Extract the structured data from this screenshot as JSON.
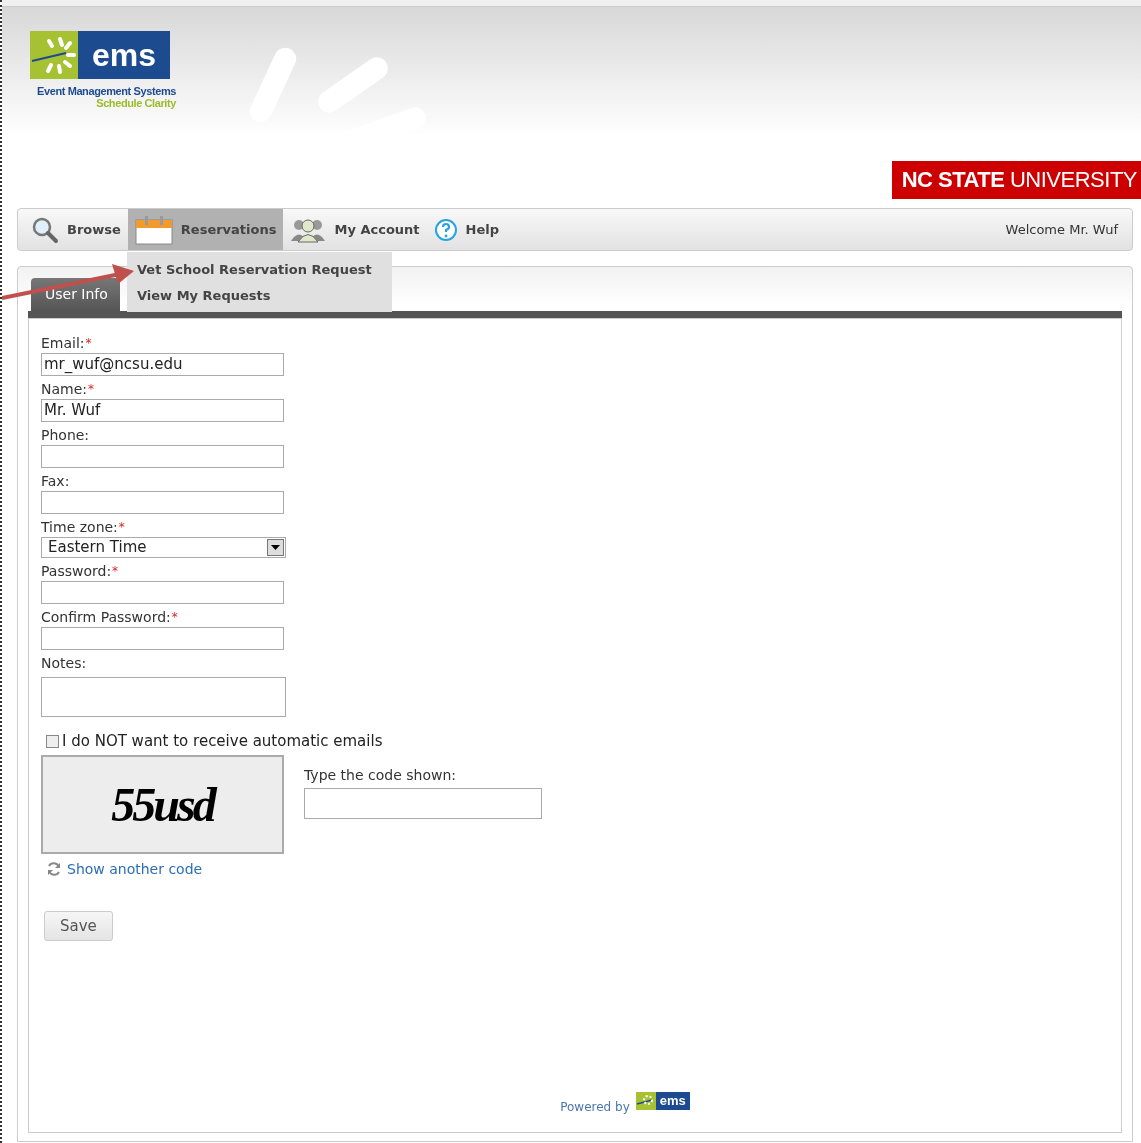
{
  "header": {
    "logo": {
      "name": "ems",
      "line1": "Event Management Systems",
      "line2": "Schedule Clarity"
    },
    "university": {
      "bold": "NC STATE",
      "rest": "UNIVERSITY"
    }
  },
  "nav": {
    "items": [
      {
        "label": "Browse",
        "kind": "search",
        "selected": false
      },
      {
        "label": "Reservations",
        "kind": "calendar",
        "selected": true
      },
      {
        "label": "My Account",
        "kind": "people",
        "selected": false
      },
      {
        "label": "Help",
        "kind": "help",
        "selected": false
      }
    ],
    "welcome": "Welcome Mr. Wuf"
  },
  "dropdown": {
    "items": [
      "Vet School Reservation Request",
      "View My Requests"
    ]
  },
  "tabs": [
    {
      "label": "User Info",
      "selected": true
    }
  ],
  "form": {
    "fields": [
      {
        "kind": "text",
        "label": "Email:",
        "required_mark": "*",
        "value": "mr_wuf@ncsu.edu"
      },
      {
        "kind": "text",
        "label": "Name:",
        "required_mark": "*",
        "value": "Mr. Wuf"
      },
      {
        "kind": "text",
        "label": "Phone:"
      },
      {
        "kind": "text",
        "label": "Fax:"
      },
      {
        "kind": "select",
        "label": "Time zone:",
        "required_mark": "*",
        "value": "Eastern Time"
      },
      {
        "kind": "password",
        "label": "Password:",
        "required_mark": "*"
      },
      {
        "kind": "password",
        "label": "Confirm Password:",
        "required_mark": "*"
      },
      {
        "kind": "textarea",
        "label": "Notes:"
      }
    ],
    "opt_out": {
      "label": "I do NOT want to receive automatic emails",
      "checked": false
    },
    "captcha": {
      "code": "55usd",
      "prompt": "Type the code shown:",
      "refresh_link": "Show another code"
    },
    "save_button": "Save"
  },
  "footer": {
    "powered_by": "Powered by",
    "logo": "ems"
  }
}
